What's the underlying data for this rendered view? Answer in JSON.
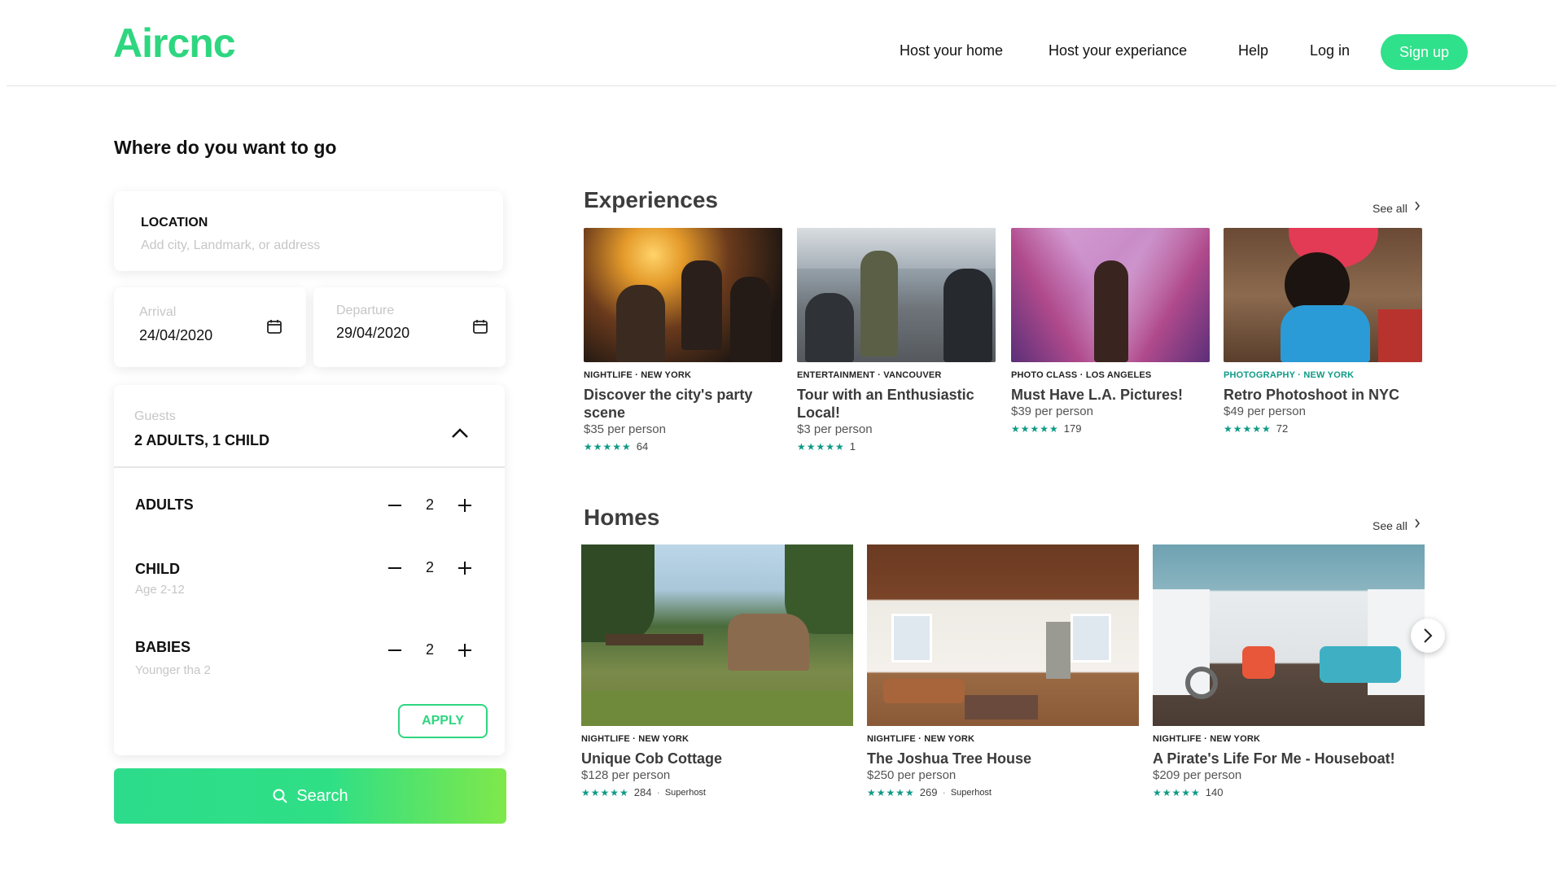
{
  "header": {
    "logo": "Aircnc",
    "nav": [
      "Host your home",
      "Host your experiance",
      "Help",
      "Log in"
    ],
    "signup": "Sign up"
  },
  "search": {
    "heading": "Where do you want to go",
    "location_label": "LOCATION",
    "location_placeholder": "Add city, Landmark, or address",
    "arrival_label": "Arrival",
    "arrival_value": "24/04/2020",
    "departure_label": "Departure",
    "departure_value": "29/04/2020",
    "guests_label": "Guests",
    "guests_value": "2 ADULTS, 1 CHILD",
    "rows": [
      {
        "label": "ADULTS",
        "sub": "",
        "value": "2"
      },
      {
        "label": "CHILD",
        "sub": "Age 2-12",
        "value": "2"
      },
      {
        "label": "BABIES",
        "sub": "Younger tha 2",
        "value": "2"
      }
    ],
    "apply": "APPLY",
    "search_button": "Search"
  },
  "experiences": {
    "title": "Experiences",
    "see_all": "See all",
    "items": [
      {
        "category": "NIGHTLIFE · NEW YORK",
        "title": "Discover the city's party scene",
        "price": "$35 per person",
        "rating_count": "64"
      },
      {
        "category": "ENTERTAINMENT · VANCOUVER",
        "title": "Tour with an Enthusiastic Local!",
        "price": "$3 per person",
        "rating_count": "1"
      },
      {
        "category": "PHOTO CLASS · LOS ANGELES",
        "title": "Must Have L.A. Pictures!",
        "price": "$39 per person",
        "rating_count": "179"
      },
      {
        "category": "PHOTOGRAPHY · NEW YORK",
        "title": "Retro Photoshoot in NYC",
        "price": "$49 per person",
        "rating_count": "72"
      }
    ]
  },
  "homes": {
    "title": "Homes",
    "see_all": "See all",
    "items": [
      {
        "category": "NIGHTLIFE · NEW YORK",
        "title": "Unique Cob Cottage",
        "price": "$128 per person",
        "rating_count": "284",
        "badge": "Superhost"
      },
      {
        "category": "NIGHTLIFE · NEW YORK",
        "title": "The Joshua Tree House",
        "price": "$250 per person",
        "rating_count": "269",
        "badge": "Superhost"
      },
      {
        "category": "NIGHTLIFE · NEW YORK",
        "title": "A Pirate's Life For Me - Houseboat!",
        "price": "$209 per person",
        "rating_count": "140",
        "badge": ""
      }
    ]
  },
  "stars": "★★★★★",
  "colors": {
    "brand": "#2dd67f",
    "teal": "#0f9a86"
  }
}
